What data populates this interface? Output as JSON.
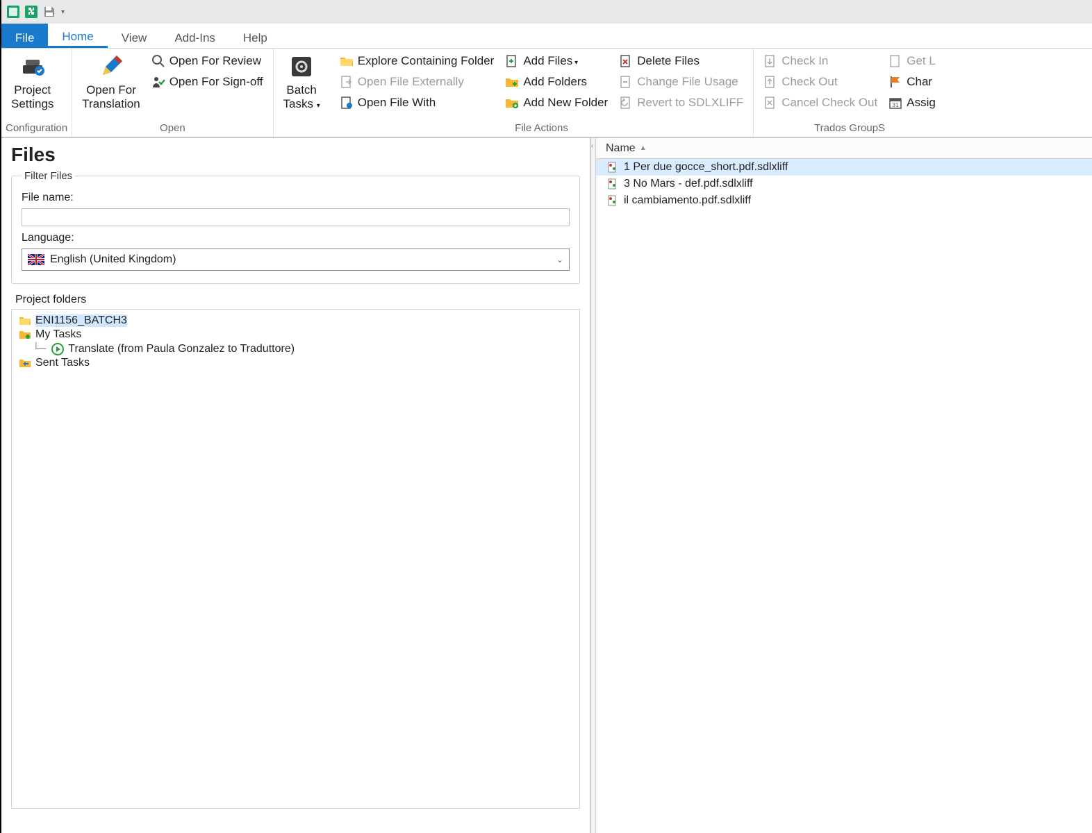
{
  "titlebar": {
    "icons": [
      "app-icon",
      "puzzle-icon",
      "save-icon"
    ]
  },
  "tabs": {
    "file": "File",
    "items": [
      "Home",
      "View",
      "Add-Ins",
      "Help"
    ],
    "active_index": 0
  },
  "ribbon": {
    "groups": [
      {
        "label": "Configuration",
        "big": [
          {
            "name": "project-settings",
            "line1": "Project",
            "line2": "Settings",
            "icon": "project-settings-icon"
          }
        ]
      },
      {
        "label": "Open",
        "big": [
          {
            "name": "open-for-translation",
            "line1": "Open For",
            "line2": "Translation",
            "icon": "pencil-icon"
          }
        ],
        "small": [
          {
            "name": "open-for-review",
            "label": "Open For Review",
            "icon": "magnifier-icon",
            "enabled": true
          },
          {
            "name": "open-for-signoff",
            "label": "Open For Sign-off",
            "icon": "signoff-icon",
            "enabled": true
          }
        ]
      },
      {
        "label": "",
        "big": [
          {
            "name": "batch-tasks",
            "line1": "Batch",
            "line2": "Tasks",
            "icon": "gear-box-icon",
            "dropdown": true
          }
        ]
      },
      {
        "label": "File Actions",
        "columns": [
          [
            {
              "name": "explore-containing-folder",
              "label": "Explore Containing Folder",
              "icon": "folder-open-icon",
              "enabled": true
            },
            {
              "name": "open-file-externally",
              "label": "Open File Externally",
              "icon": "file-external-icon",
              "enabled": false
            },
            {
              "name": "open-file-with",
              "label": "Open File With",
              "icon": "file-open-icon",
              "enabled": true
            }
          ],
          [
            {
              "name": "add-files",
              "label": "Add Files",
              "icon": "file-add-icon",
              "enabled": true,
              "dropdown": true
            },
            {
              "name": "add-folders",
              "label": "Add Folders",
              "icon": "folder-add-icon",
              "enabled": true
            },
            {
              "name": "add-new-folder",
              "label": "Add New Folder",
              "icon": "folder-new-icon",
              "enabled": true
            }
          ],
          [
            {
              "name": "delete-files",
              "label": "Delete Files",
              "icon": "file-delete-icon",
              "enabled": true
            },
            {
              "name": "change-file-usage",
              "label": "Change File Usage",
              "icon": "file-change-icon",
              "enabled": false
            },
            {
              "name": "revert-to-sdlxliff",
              "label": "Revert to SDLXLIFF",
              "icon": "file-revert-icon",
              "enabled": false
            }
          ]
        ]
      },
      {
        "label": "Trados GroupS",
        "columns": [
          [
            {
              "name": "check-in",
              "label": "Check In",
              "icon": "checkin-icon",
              "enabled": false
            },
            {
              "name": "check-out",
              "label": "Check Out",
              "icon": "checkout-icon",
              "enabled": false
            },
            {
              "name": "cancel-check-out",
              "label": "Cancel Check Out",
              "icon": "cancel-checkout-icon",
              "enabled": false
            }
          ],
          [
            {
              "name": "get-latest",
              "label": "Get L",
              "icon": "get-icon",
              "enabled": false
            },
            {
              "name": "change-phase",
              "label": "Char",
              "icon": "flag-icon",
              "enabled": true
            },
            {
              "name": "assign",
              "label": "Assig",
              "icon": "calendar-icon",
              "enabled": true
            }
          ]
        ]
      }
    ]
  },
  "left": {
    "title": "Files",
    "filter_legend": "Filter Files",
    "file_name_label": "File name:",
    "file_name_value": "",
    "language_label": "Language:",
    "language_value": "English (United Kingdom)",
    "project_folders_label": "Project folders",
    "tree": [
      {
        "name": "project-root",
        "label": "ENI1156_BATCH3",
        "icon": "folder-open-icon",
        "indent": 0,
        "selected": true
      },
      {
        "name": "my-tasks",
        "label": "My Tasks",
        "icon": "tasks-folder-icon",
        "indent": 0,
        "selected": false
      },
      {
        "name": "translate-task",
        "label": "Translate (from Paula Gonzalez to Traduttore)",
        "icon": "play-circle-icon",
        "indent": 2,
        "selected": false,
        "branch": true
      },
      {
        "name": "sent-tasks",
        "label": "Sent Tasks",
        "icon": "sent-folder-icon",
        "indent": 0,
        "selected": false
      }
    ]
  },
  "right": {
    "header_name": "Name",
    "files": [
      {
        "label": "1 Per due gocce_short.pdf.sdlxliff",
        "selected": true
      },
      {
        "label": "3 No Mars - def.pdf.sdlxliff",
        "selected": false
      },
      {
        "label": "il cambiamento.pdf.sdlxliff",
        "selected": false
      }
    ]
  }
}
